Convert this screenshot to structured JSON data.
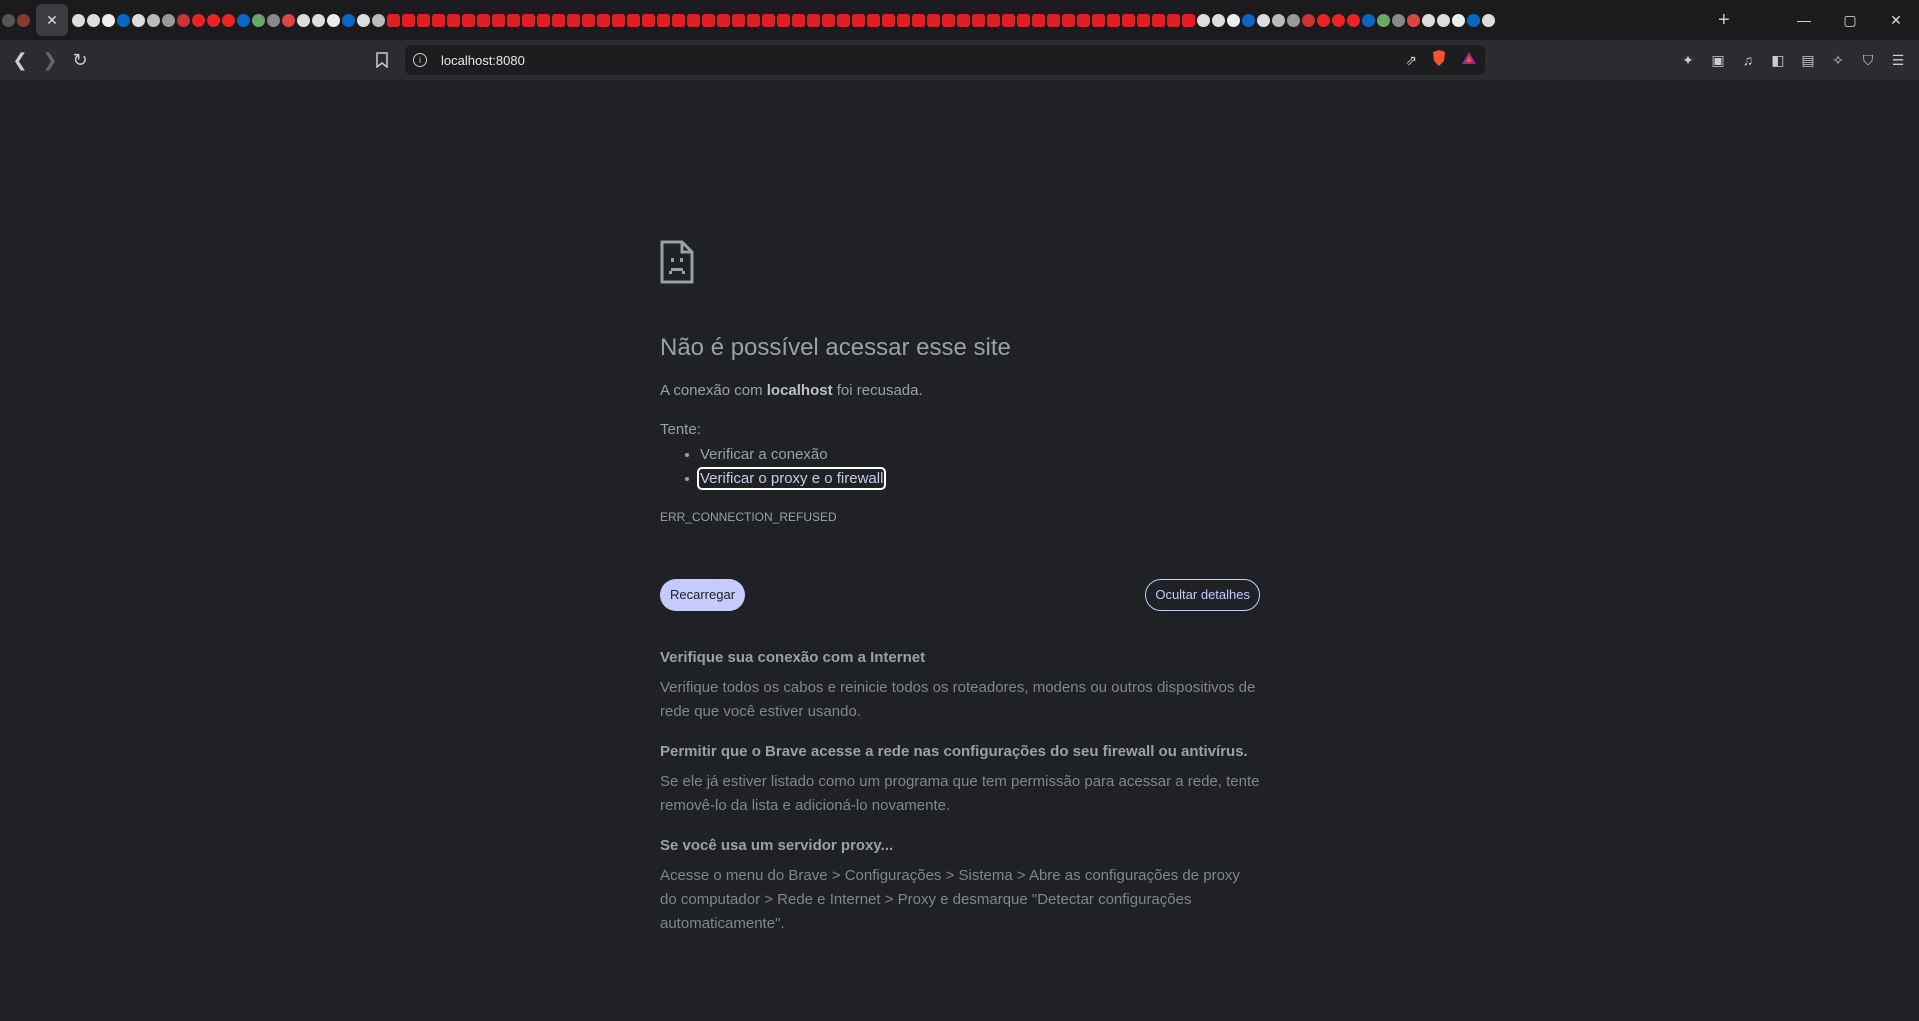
{
  "browser": {
    "active_tab_close": "✕",
    "new_tab": "+",
    "url": "localhost:8080",
    "window_controls": [
      "—",
      "▢",
      "✕"
    ]
  },
  "error": {
    "title": "Não é possível acessar esse site",
    "message_prefix": "A conexão com ",
    "message_host": "localhost",
    "message_suffix": " foi recusada.",
    "try_label": "Tente:",
    "suggestions": [
      "Verificar a conexão",
      "Verificar o proxy e o firewall"
    ],
    "code": "ERR_CONNECTION_REFUSED",
    "reload_label": "Recarregar",
    "details_label": "Ocultar detalhes"
  },
  "details": [
    {
      "heading": "Verifique sua conexão com a Internet",
      "body": "Verifique todos os cabos e reinicie todos os roteadores, modens ou outros dispositivos de rede que você estiver usando."
    },
    {
      "heading": "Permitir que o Brave acesse a rede nas configurações do seu firewall ou antivírus.",
      "body": "Se ele já estiver listado como um programa que tem permissão para acessar a rede, tente removê-lo da lista e adicioná-lo novamente."
    },
    {
      "heading": "Se você usa um servidor proxy...",
      "body": "Acesse o menu do Brave > Configurações > Sistema > Abre as configurações de proxy do computador > Rede e Internet > Proxy e desmarque \"Detectar configurações automaticamente\"."
    }
  ],
  "colors": {
    "background": "#202124",
    "accent": "#c5cbff",
    "text": "#9aa0a6"
  }
}
